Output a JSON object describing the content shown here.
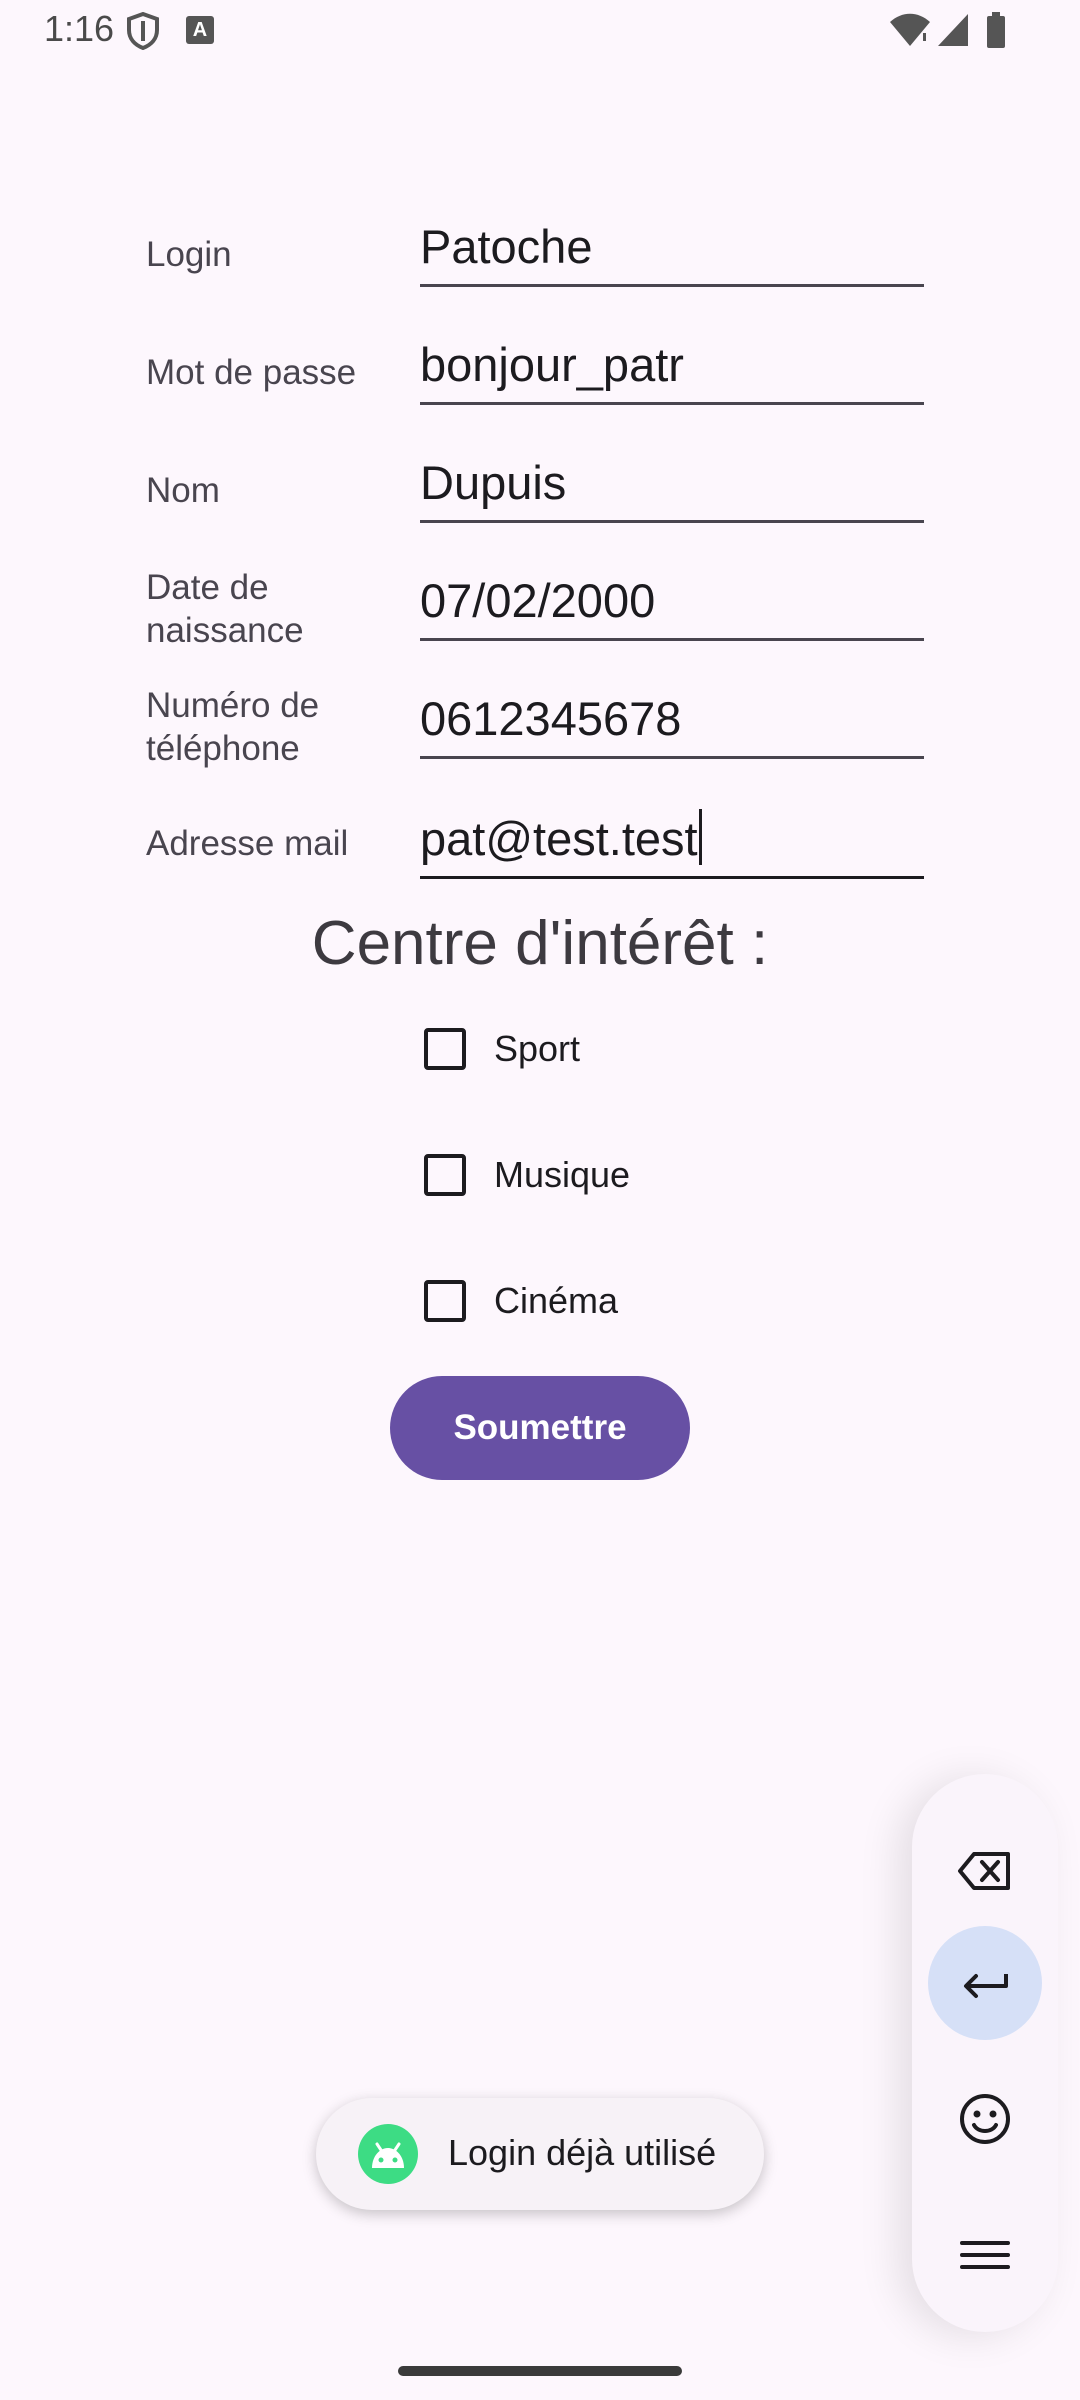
{
  "status_bar": {
    "time": "1:16",
    "icons": [
      "shield-icon",
      "keyboard-a-icon",
      "wifi-icon",
      "signal-icon",
      "battery-icon"
    ],
    "a_badge": "A"
  },
  "form": {
    "fields": [
      {
        "label": "Login",
        "value": "Patoche"
      },
      {
        "label": "Mot de passe",
        "value": "bonjour_patr"
      },
      {
        "label": "Nom",
        "value": "Dupuis"
      },
      {
        "label": "Date de naissance",
        "value": "07/02/2000"
      },
      {
        "label": "Numéro de téléphone",
        "value": "0612345678"
      },
      {
        "label": "Adresse mail",
        "value": "pat@test.test"
      }
    ]
  },
  "interests": {
    "title": "Centre d'intérêt :",
    "options": [
      {
        "label": "Sport",
        "checked": false
      },
      {
        "label": "Musique",
        "checked": false
      },
      {
        "label": "Cinéma",
        "checked": false
      }
    ]
  },
  "submit": {
    "label": "Soumettre"
  },
  "toast": {
    "text": "Login déjà utilisé",
    "icon": "android-icon"
  },
  "keyboard_panel": {
    "buttons": [
      "backspace-icon",
      "enter-icon",
      "emoji-icon",
      "menu-icon"
    ]
  },
  "colors": {
    "accent": "#6750a4",
    "background": "#fdf7fd",
    "enter_button": "#d6e0f7",
    "toast_icon": "#3ddc84"
  }
}
